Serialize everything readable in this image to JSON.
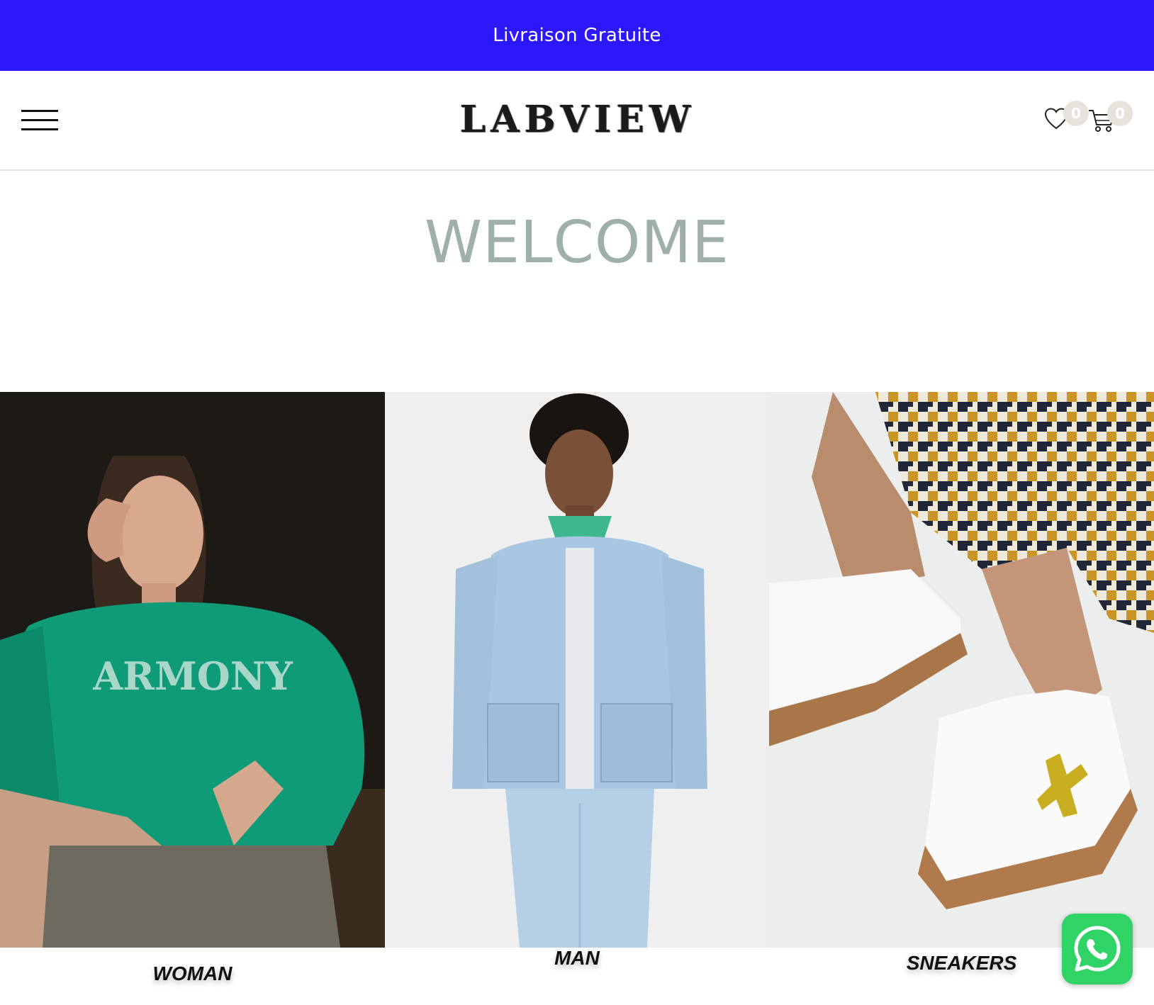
{
  "announcement": {
    "text": "Livraison Gratuite",
    "background": "#2d17fb"
  },
  "header": {
    "menu_icon": "hamburger-menu-icon",
    "logo_text": "LABVIEW",
    "wishlist": {
      "icon": "heart-icon",
      "count": "0"
    },
    "cart": {
      "icon": "shopping-cart-icon",
      "count": "0"
    }
  },
  "hero": {
    "title": "WELCOME",
    "title_color": "#9fafaa"
  },
  "categories": [
    {
      "label": "WOMAN"
    },
    {
      "label": "MAN"
    },
    {
      "label": "SNEAKERS"
    }
  ],
  "chat": {
    "icon": "whatsapp-icon",
    "color": "#2fd366"
  }
}
